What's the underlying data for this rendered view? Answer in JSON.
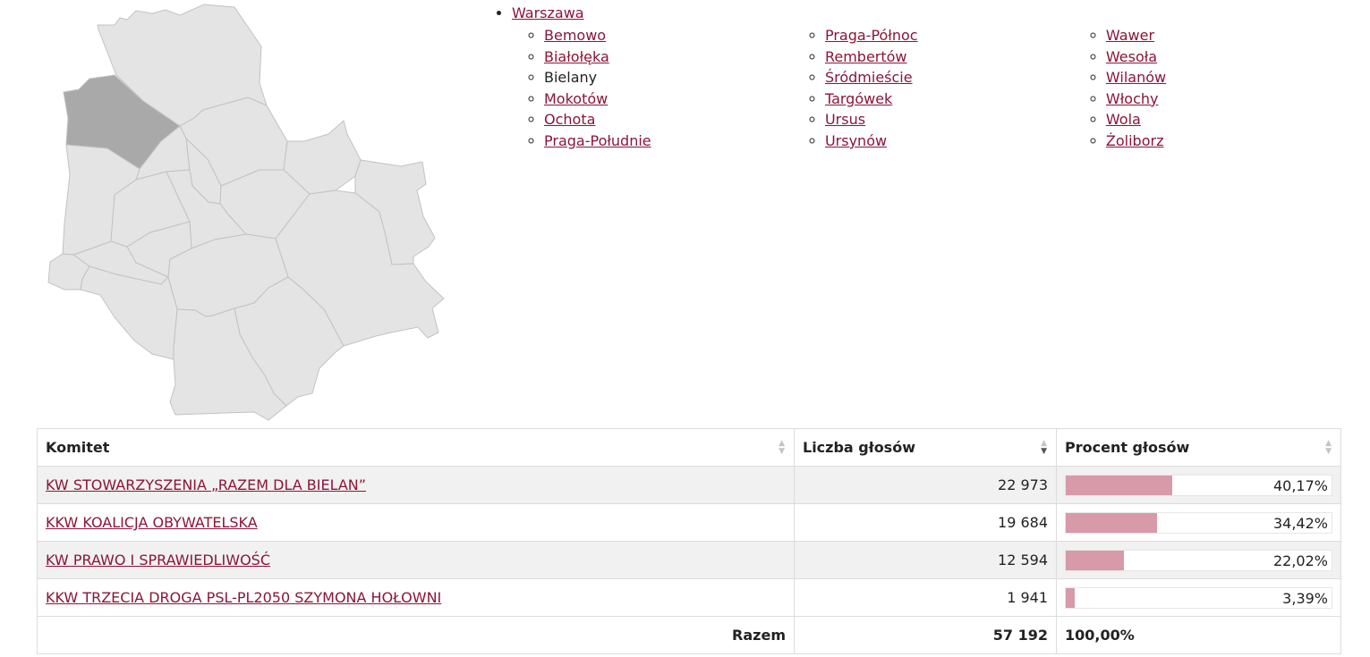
{
  "nav": {
    "root": "Warszawa",
    "current": "Bielany",
    "columns": [
      [
        "Bemowo",
        "Białołęka",
        "Bielany",
        "Mokotów",
        "Ochota",
        "Praga-Południe"
      ],
      [
        "Praga-Północ",
        "Rembertów",
        "Śródmieście",
        "Targówek",
        "Ursus",
        "Ursynów"
      ],
      [
        "Wawer",
        "Wesoła",
        "Wilanów",
        "Włochy",
        "Wola",
        "Żoliborz"
      ]
    ]
  },
  "map": {
    "fill_color": "#e4e4e4",
    "selected_color": "#a9a9a9",
    "stroke_color": "#c2c2c2"
  },
  "table": {
    "headers": {
      "komitet": "Komitet",
      "glosy": "Liczba głosów",
      "procent": "Procent głosów"
    },
    "rows": [
      {
        "name": "KW STOWARZYSZENIA „RAZEM DLA BIELAN”",
        "votes": "22 973",
        "percent": "40,17%",
        "share": 40.17
      },
      {
        "name": "KKW KOALICJA OBYWATELSKA",
        "votes": "19 684",
        "percent": "34,42%",
        "share": 34.42
      },
      {
        "name": "KW PRAWO I SPRAWIEDLIWOŚĆ",
        "votes": "12 594",
        "percent": "22,02%",
        "share": 22.02
      },
      {
        "name": "KKW TRZECIA DROGA PSL-PL2050 SZYMONA HOŁOWNI",
        "votes": "1 941",
        "percent": "3,39%",
        "share": 3.39
      }
    ],
    "total": {
      "label": "Razem",
      "votes": "57 192",
      "percent": "100,00%"
    },
    "bar_color": "#d89aa8",
    "link_color": "#8b1538"
  }
}
